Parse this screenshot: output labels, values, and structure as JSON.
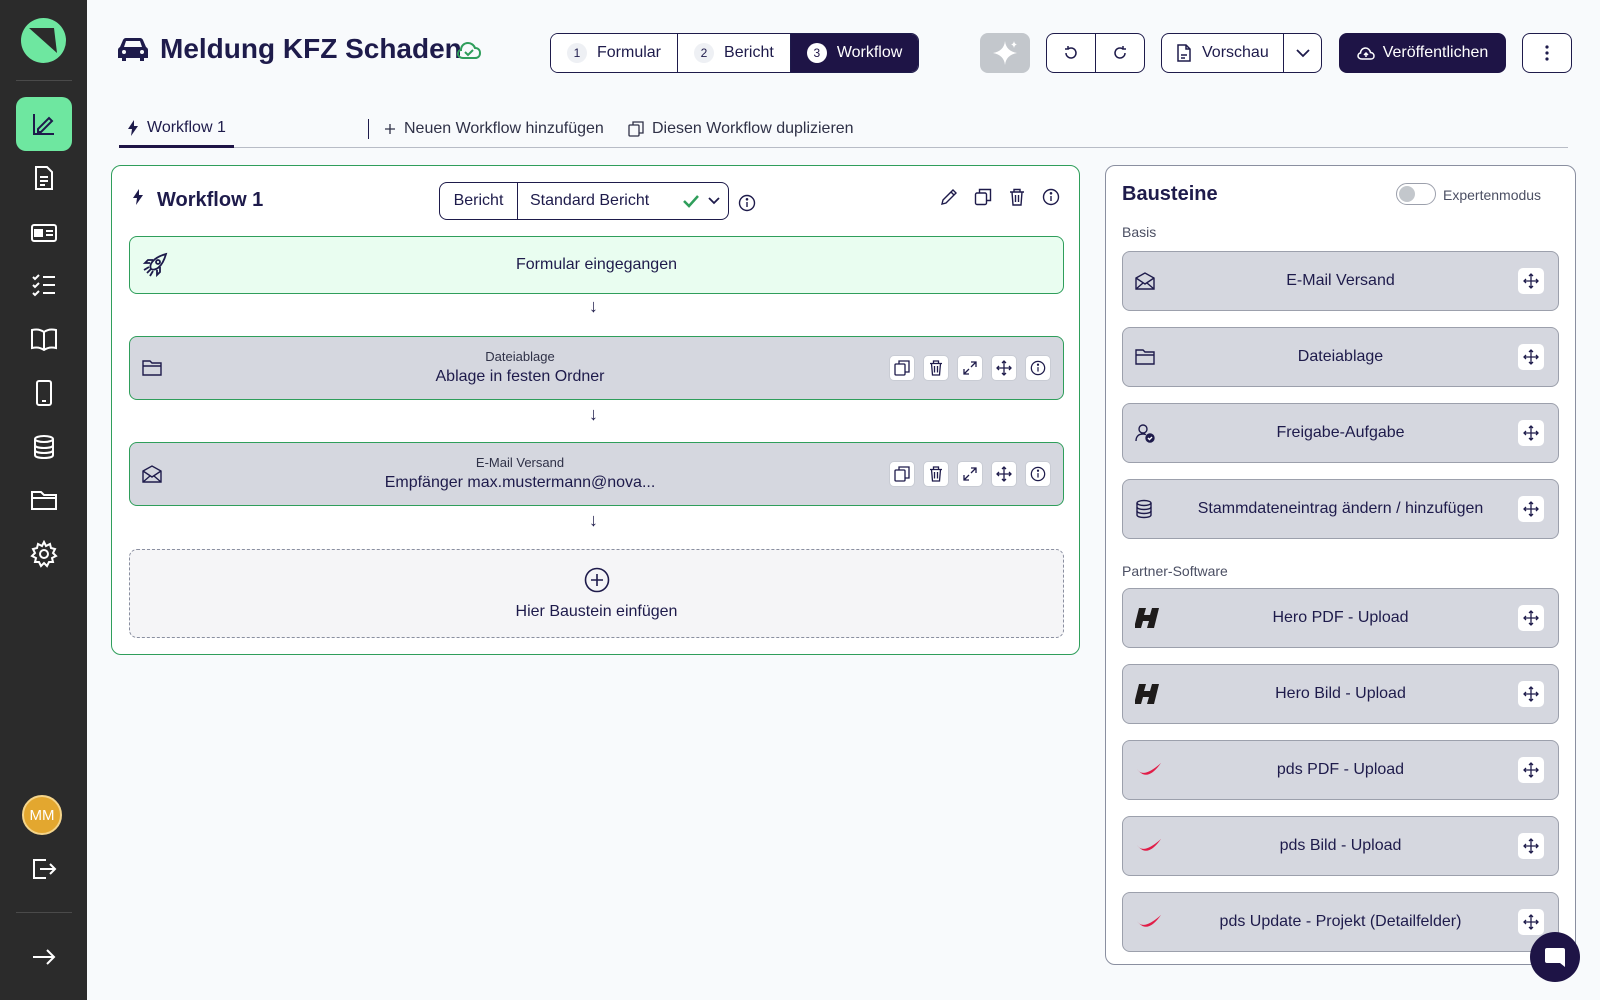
{
  "header": {
    "title": "Meldung KFZ Schaden",
    "steps": [
      {
        "num": "1",
        "label": "Formular"
      },
      {
        "num": "2",
        "label": "Bericht"
      },
      {
        "num": "3",
        "label": "Workflow"
      }
    ],
    "preview_label": "Vorschau",
    "publish_label": "Veröffentlichen"
  },
  "sidebar": {
    "avatar_initials": "MM",
    "accent_color": "#6ee7a0"
  },
  "subtabs": {
    "workflow_tab": "Workflow 1",
    "add_workflow": "Neuen Workflow hinzufügen",
    "duplicate_workflow": "Diesen Workflow duplizieren"
  },
  "workflow": {
    "title": "Workflow 1",
    "report_label": "Bericht",
    "report_value": "Standard Bericht",
    "trigger": "Formular eingegangen",
    "nodes": [
      {
        "type": "Dateiablage",
        "value": "Ablage in festen Ordner"
      },
      {
        "type": "E-Mail Versand",
        "value": "Empfänger max.mustermann@nova..."
      }
    ],
    "insert_label": "Hier Baustein einfügen"
  },
  "bausteine": {
    "title": "Bausteine",
    "expert_mode_label": "Expertenmodus",
    "expert_mode_on": false,
    "section_basis": "Basis",
    "basis_items": [
      "E-Mail Versand",
      "Dateiablage",
      "Freigabe-Aufgabe",
      "Stammdateneintrag ändern / hinzufügen"
    ],
    "section_partner": "Partner-Software",
    "partner_items": [
      "Hero PDF - Upload",
      "Hero Bild - Upload",
      "pds PDF - Upload",
      "pds Bild - Upload",
      "pds Update - Projekt (Detailfelder)"
    ]
  }
}
